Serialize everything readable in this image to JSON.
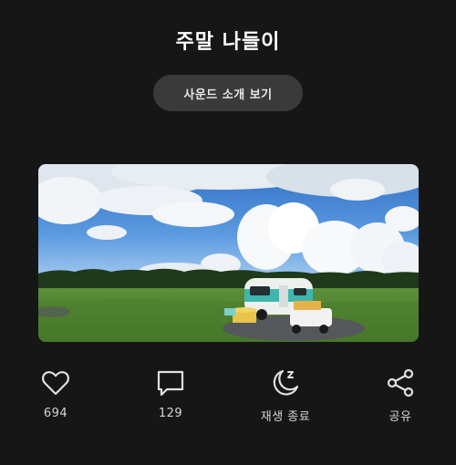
{
  "header": {
    "title": "주말 나들이"
  },
  "intro_button": {
    "label": "사운드 소개 보기"
  },
  "photo": {
    "subject": "camper-trailer-in-meadow"
  },
  "actions": [
    {
      "icon": "heart-icon",
      "label": "694"
    },
    {
      "icon": "comment-icon",
      "label": "129"
    },
    {
      "icon": "sleep-timer-icon",
      "label": "재생 종료"
    },
    {
      "icon": "share-icon",
      "label": "공유"
    }
  ],
  "colors": {
    "background": "#161616",
    "button_bg": "#3a3a3a",
    "text": "#ffffff"
  }
}
